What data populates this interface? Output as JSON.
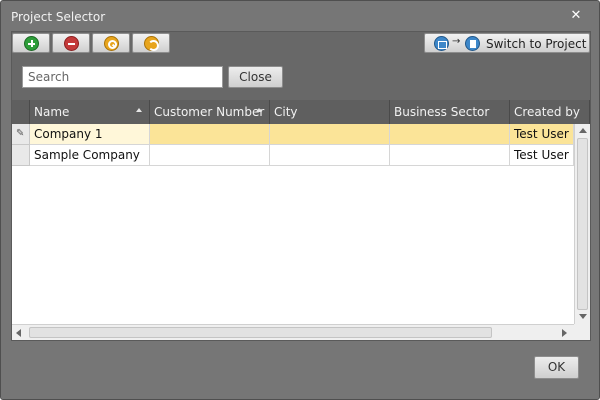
{
  "window": {
    "title": "Project Selector"
  },
  "toolbar": {
    "buttons": [
      {
        "icon": "add-icon"
      },
      {
        "icon": "remove-icon"
      },
      {
        "icon": "key-icon"
      },
      {
        "icon": "refresh-icon"
      }
    ],
    "switch_label": "Switch to Project",
    "switch_icons": [
      "building-icon",
      "arrow-right-icon",
      "document-icon"
    ]
  },
  "search": {
    "placeholder": "Search",
    "value": "",
    "close_label": "Close"
  },
  "grid": {
    "columns": [
      "Name",
      "Customer Number",
      "City",
      "Business Sector",
      "Created by"
    ],
    "sorted_columns": [
      "Name",
      "Customer Number"
    ],
    "rows": [
      {
        "name": "Company 1",
        "customer_number": "",
        "city": "",
        "business_sector": "",
        "created_by": "Test User",
        "selected": true
      },
      {
        "name": "Sample Company",
        "customer_number": "",
        "city": "",
        "business_sector": "",
        "created_by": "Test User",
        "selected": false
      }
    ]
  },
  "footer": {
    "ok_label": "OK"
  },
  "colors": {
    "selected_row": "#fbe498",
    "header": "#5f5f5f",
    "window": "#767676"
  }
}
